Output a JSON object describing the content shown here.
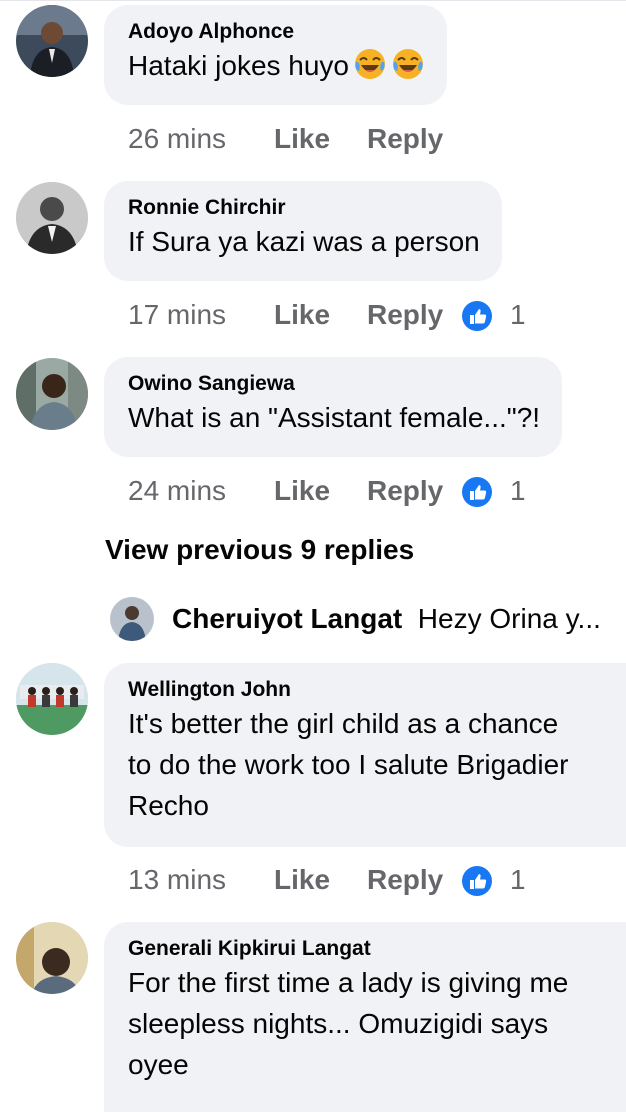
{
  "comments": [
    {
      "name": "Adoyo Alphonce",
      "text": "Hataki jokes huyo",
      "emoji": "laughing-tears-emoji",
      "time": "26 mins",
      "like": "Like",
      "reply": "Reply"
    },
    {
      "name": "Ronnie Chirchir",
      "text": "If Sura ya kazi was a person",
      "time": "17 mins",
      "like": "Like",
      "reply": "Reply",
      "reactions": "1"
    },
    {
      "name": "Owino Sangiewa",
      "text": "What is an \"Assistant female...\"?!",
      "time": "24 mins",
      "like": "Like",
      "reply": "Reply",
      "reactions": "1"
    },
    {
      "name": "Wellington John",
      "text_lines": [
        "It's better the girl child as a chance",
        "to do the work too I salute  Brigadier",
        "Recho"
      ],
      "time": "13 mins",
      "like": "Like",
      "reply": "Reply",
      "reactions": "1"
    },
    {
      "name": "Generali Kipkirui Langat",
      "text_lines": [
        "For the first time a lady is giving me",
        "sleepless nights... Omuzigidi says",
        "oyee"
      ]
    }
  ],
  "view_previous": "View previous 9 replies",
  "collapsed_reply": {
    "name": "Cheruiyot Langat",
    "preview": "Hezy Orina y..."
  },
  "colors": {
    "bubble": "#f0f2f5",
    "meta": "#65676b",
    "like_blue": "#1877f2",
    "text": "#050505"
  }
}
